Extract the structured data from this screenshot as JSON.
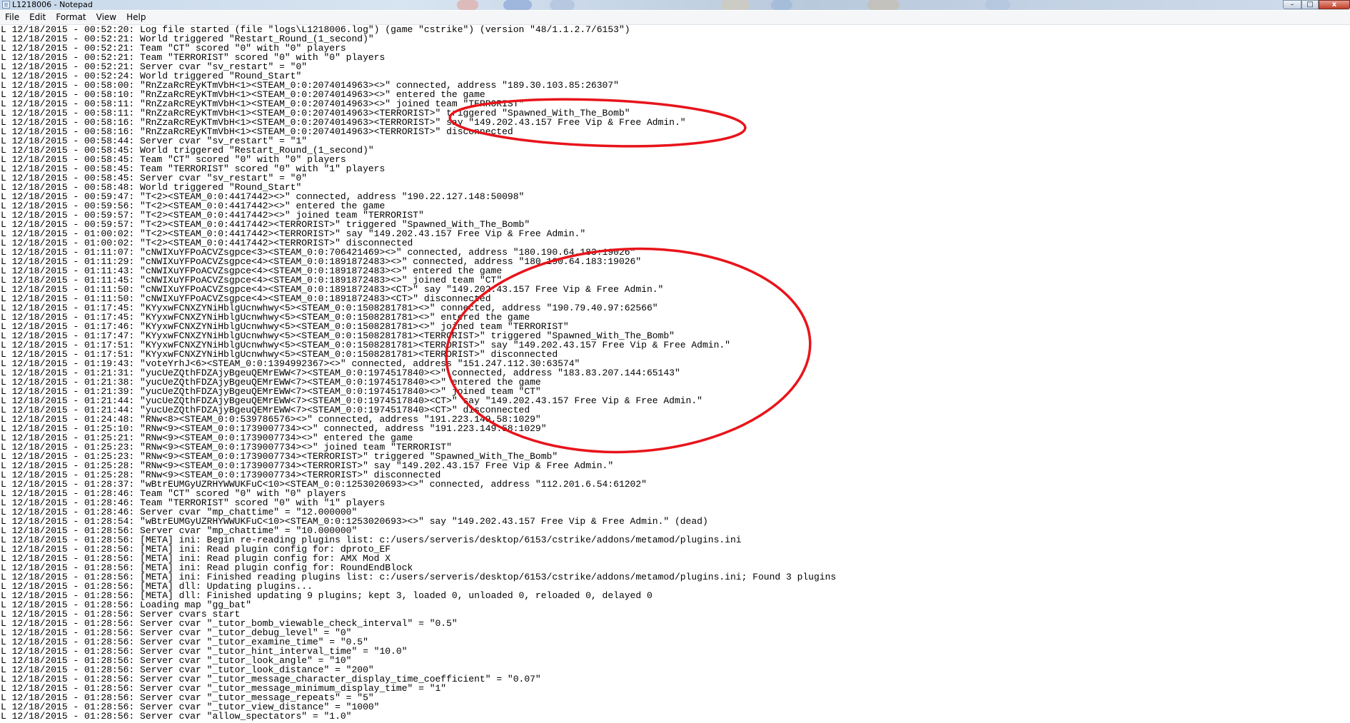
{
  "window": {
    "title": "L1218006 - Notepad",
    "controls": {
      "minimize": "–",
      "maximize": "□",
      "close": "x"
    }
  },
  "menu": [
    "File",
    "Edit",
    "Format",
    "View",
    "Help"
  ],
  "annotation_color": "#e8141b",
  "log_lines": [
    "L 12/18/2015 - 00:52:20: Log file started (file \"logs\\L1218006.log\") (game \"cstrike\") (version \"48/1.1.2.7/6153\")",
    "L 12/18/2015 - 00:52:21: World triggered \"Restart_Round_(1_second)\"",
    "L 12/18/2015 - 00:52:21: Team \"CT\" scored \"0\" with \"0\" players",
    "L 12/18/2015 - 00:52:21: Team \"TERRORIST\" scored \"0\" with \"0\" players",
    "L 12/18/2015 - 00:52:21: Server cvar \"sv_restart\" = \"0\"",
    "L 12/18/2015 - 00:52:24: World triggered \"Round_Start\"",
    "L 12/18/2015 - 00:58:00: \"RnZzaRcREyKTmVbH<1><STEAM_0:0:2074014963><>\" connected, address \"189.30.103.85:26307\"",
    "L 12/18/2015 - 00:58:10: \"RnZzaRcREyKTmVbH<1><STEAM_0:0:2074014963><>\" entered the game",
    "L 12/18/2015 - 00:58:11: \"RnZzaRcREyKTmVbH<1><STEAM_0:0:2074014963><>\" joined team \"TERRORIST\"",
    "L 12/18/2015 - 00:58:11: \"RnZzaRcREyKTmVbH<1><STEAM_0:0:2074014963><TERRORIST>\" triggered \"Spawned_With_The_Bomb\"",
    "L 12/18/2015 - 00:58:16: \"RnZzaRcREyKTmVbH<1><STEAM_0:0:2074014963><TERRORIST>\" say \"149.202.43.157 Free Vip & Free Admin.\"",
    "L 12/18/2015 - 00:58:16: \"RnZzaRcREyKTmVbH<1><STEAM_0:0:2074014963><TERRORIST>\" disconnected",
    "L 12/18/2015 - 00:58:44: Server cvar \"sv_restart\" = \"1\"",
    "L 12/18/2015 - 00:58:45: World triggered \"Restart_Round_(1_second)\"",
    "L 12/18/2015 - 00:58:45: Team \"CT\" scored \"0\" with \"0\" players",
    "L 12/18/2015 - 00:58:45: Team \"TERRORIST\" scored \"0\" with \"1\" players",
    "L 12/18/2015 - 00:58:45: Server cvar \"sv_restart\" = \"0\"",
    "L 12/18/2015 - 00:58:48: World triggered \"Round_Start\"",
    "L 12/18/2015 - 00:59:47: \"T<2><STEAM_0:0:4417442><>\" connected, address \"190.22.127.148:50098\"",
    "L 12/18/2015 - 00:59:56: \"T<2><STEAM_0:0:4417442><>\" entered the game",
    "L 12/18/2015 - 00:59:57: \"T<2><STEAM_0:0:4417442><>\" joined team \"TERRORIST\"",
    "L 12/18/2015 - 00:59:57: \"T<2><STEAM_0:0:4417442><TERRORIST>\" triggered \"Spawned_With_The_Bomb\"",
    "L 12/18/2015 - 01:00:02: \"T<2><STEAM_0:0:4417442><TERRORIST>\" say \"149.202.43.157 Free Vip & Free Admin.\"",
    "L 12/18/2015 - 01:00:02: \"T<2><STEAM_0:0:4417442><TERRORIST>\" disconnected",
    "L 12/18/2015 - 01:11:07: \"cNWIXuYFPoACVZsgpce<3><STEAM_0:0:706421469><>\" connected, address \"180.190.64.183:19026\"",
    "L 12/18/2015 - 01:11:29: \"cNWIXuYFPoACVZsgpce<4><STEAM_0:0:1891872483><>\" connected, address \"180.190.64.183:19026\"",
    "L 12/18/2015 - 01:11:43: \"cNWIXuYFPoACVZsgpce<4><STEAM_0:0:1891872483><>\" entered the game",
    "L 12/18/2015 - 01:11:45: \"cNWIXuYFPoACVZsgpce<4><STEAM_0:0:1891872483><>\" joined team \"CT\"",
    "L 12/18/2015 - 01:11:50: \"cNWIXuYFPoACVZsgpce<4><STEAM_0:0:1891872483><CT>\" say \"149.202.43.157 Free Vip & Free Admin.\"",
    "L 12/18/2015 - 01:11:50: \"cNWIXuYFPoACVZsgpce<4><STEAM_0:0:1891872483><CT>\" disconnected",
    "L 12/18/2015 - 01:17:45: \"KYyxwFCNXZYNiHblgUcnwhwy<5><STEAM_0:0:1508281781><>\" connected, address \"190.79.40.97:62566\"",
    "L 12/18/2015 - 01:17:45: \"KYyxwFCNXZYNiHblgUcnwhwy<5><STEAM_0:0:1508281781><>\" entered the game",
    "L 12/18/2015 - 01:17:46: \"KYyxwFCNXZYNiHblgUcnwhwy<5><STEAM_0:0:1508281781><>\" joined team \"TERRORIST\"",
    "L 12/18/2015 - 01:17:47: \"KYyxwFCNXZYNiHblgUcnwhwy<5><STEAM_0:0:1508281781><TERRORIST>\" triggered \"Spawned_With_The_Bomb\"",
    "L 12/18/2015 - 01:17:51: \"KYyxwFCNXZYNiHblgUcnwhwy<5><STEAM_0:0:1508281781><TERRORIST>\" say \"149.202.43.157 Free Vip & Free Admin.\"",
    "L 12/18/2015 - 01:17:51: \"KYyxwFCNXZYNiHblgUcnwhwy<5><STEAM_0:0:1508281781><TERRORIST>\" disconnected",
    "L 12/18/2015 - 01:19:43: \"voteYrhJ<6><STEAM_0:0:1394992367><>\" connected, address \"151.247.112.30:63574\"",
    "L 12/18/2015 - 01:21:31: \"yucUeZQthFDZAjyBgeuQEMrEWW<7><STEAM_0:0:1974517840><>\" connected, address \"183.83.207.144:65143\"",
    "L 12/18/2015 - 01:21:38: \"yucUeZQthFDZAjyBgeuQEMrEWW<7><STEAM_0:0:1974517840><>\" entered the game",
    "L 12/18/2015 - 01:21:39: \"yucUeZQthFDZAjyBgeuQEMrEWW<7><STEAM_0:0:1974517840><>\" joined team \"CT\"",
    "L 12/18/2015 - 01:21:44: \"yucUeZQthFDZAjyBgeuQEMrEWW<7><STEAM_0:0:1974517840><CT>\" say \"149.202.43.157 Free Vip & Free Admin.\"",
    "L 12/18/2015 - 01:21:44: \"yucUeZQthFDZAjyBgeuQEMrEWW<7><STEAM_0:0:1974517840><CT>\" disconnected",
    "L 12/18/2015 - 01:24:48: \"RNw<8><STEAM_0:0:539786576><>\" connected, address \"191.223.149.58:1029\"",
    "L 12/18/2015 - 01:25:10: \"RNw<9><STEAM_0:0:1739007734><>\" connected, address \"191.223.149.58:1029\"",
    "L 12/18/2015 - 01:25:21: \"RNw<9><STEAM_0:0:1739007734><>\" entered the game",
    "L 12/18/2015 - 01:25:23: \"RNw<9><STEAM_0:0:1739007734><>\" joined team \"TERRORIST\"",
    "L 12/18/2015 - 01:25:23: \"RNw<9><STEAM_0:0:1739007734><TERRORIST>\" triggered \"Spawned_With_The_Bomb\"",
    "L 12/18/2015 - 01:25:28: \"RNw<9><STEAM_0:0:1739007734><TERRORIST>\" say \"149.202.43.157 Free Vip & Free Admin.\"",
    "L 12/18/2015 - 01:25:28: \"RNw<9><STEAM_0:0:1739007734><TERRORIST>\" disconnected",
    "L 12/18/2015 - 01:28:37: \"wBtrEUMGyUZRHYWWUKFuC<10><STEAM_0:0:1253020693><>\" connected, address \"112.201.6.54:61202\"",
    "L 12/18/2015 - 01:28:46: Team \"CT\" scored \"0\" with \"0\" players",
    "L 12/18/2015 - 01:28:46: Team \"TERRORIST\" scored \"0\" with \"1\" players",
    "L 12/18/2015 - 01:28:46: Server cvar \"mp_chattime\" = \"12.000000\"",
    "L 12/18/2015 - 01:28:54: \"wBtrEUMGyUZRHYWWUKFuC<10><STEAM_0:0:1253020693><>\" say \"149.202.43.157 Free Vip & Free Admin.\" (dead)",
    "L 12/18/2015 - 01:28:56: Server cvar \"mp_chattime\" = \"10.000000\"",
    "L 12/18/2015 - 01:28:56: [META] ini: Begin re-reading plugins list: c:/users/serveris/desktop/6153/cstrike/addons/metamod/plugins.ini",
    "L 12/18/2015 - 01:28:56: [META] ini: Read plugin config for: dproto_EF",
    "L 12/18/2015 - 01:28:56: [META] ini: Read plugin config for: AMX Mod X",
    "L 12/18/2015 - 01:28:56: [META] ini: Read plugin config for: RoundEndBlock",
    "L 12/18/2015 - 01:28:56: [META] ini: Finished reading plugins list: c:/users/serveris/desktop/6153/cstrike/addons/metamod/plugins.ini; Found 3 plugins",
    "L 12/18/2015 - 01:28:56: [META] dll: Updating plugins...",
    "L 12/18/2015 - 01:28:56: [META] dll: Finished updating 9 plugins; kept 3, loaded 0, unloaded 0, reloaded 0, delayed 0",
    "L 12/18/2015 - 01:28:56: Loading map \"gg_bat\"",
    "L 12/18/2015 - 01:28:56: Server cvars start",
    "L 12/18/2015 - 01:28:56: Server cvar \"_tutor_bomb_viewable_check_interval\" = \"0.5\"",
    "L 12/18/2015 - 01:28:56: Server cvar \"_tutor_debug_level\" = \"0\"",
    "L 12/18/2015 - 01:28:56: Server cvar \"_tutor_examine_time\" = \"0.5\"",
    "L 12/18/2015 - 01:28:56: Server cvar \"_tutor_hint_interval_time\" = \"10.0\"",
    "L 12/18/2015 - 01:28:56: Server cvar \"_tutor_look_angle\" = \"10\"",
    "L 12/18/2015 - 01:28:56: Server cvar \"_tutor_look_distance\" = \"200\"",
    "L 12/18/2015 - 01:28:56: Server cvar \"_tutor_message_character_display_time_coefficient\" = \"0.07\"",
    "L 12/18/2015 - 01:28:56: Server cvar \"_tutor_message_minimum_display_time\" = \"1\"",
    "L 12/18/2015 - 01:28:56: Server cvar \"_tutor_message_repeats\" = \"5\"",
    "L 12/18/2015 - 01:28:56: Server cvar \"_tutor_view_distance\" = \"1000\"",
    "L 12/18/2015 - 01:28:56: Server cvar \"allow_spectators\" = \"1.0\""
  ]
}
